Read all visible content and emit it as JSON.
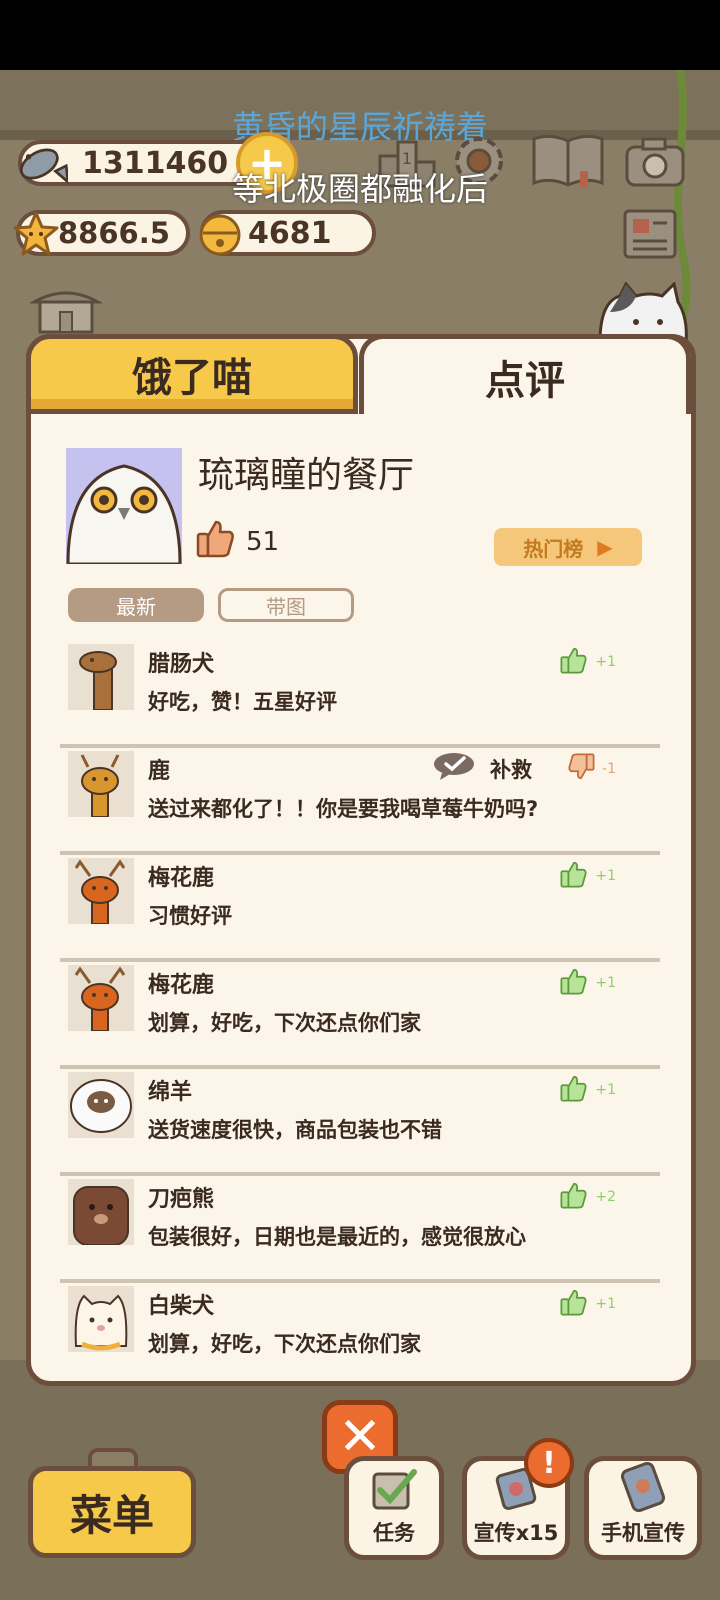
{
  "lyrics": {
    "line1": "黄昏的星辰祈祷着",
    "line2": "等北极圈都融化后"
  },
  "resources": {
    "fish": "1311460",
    "stars": "8866.5",
    "bells": "4681"
  },
  "tabs": {
    "hungry": "饿了喵",
    "review": "点评"
  },
  "profile": {
    "restaurant_name": "琉璃瞳的餐厅",
    "likes": "51",
    "hot_rank_label": "热门榜"
  },
  "filters": {
    "latest": "最新",
    "with_image": "带图"
  },
  "reviews": [
    {
      "name": "腊肠犬",
      "text": "好吃，赞！五星好评",
      "score": "+1",
      "type": "good",
      "animal": "dachshund"
    },
    {
      "name": "鹿",
      "text": "送过来都化了！！你是要我喝草莓牛奶吗?",
      "score": "-1",
      "type": "bad",
      "remedy": "补救",
      "animal": "deer"
    },
    {
      "name": "梅花鹿",
      "text": "习惯好评",
      "score": "+1",
      "type": "good",
      "animal": "sika-deer"
    },
    {
      "name": "梅花鹿",
      "text": "划算，好吃，下次还点你们家",
      "score": "+1",
      "type": "good",
      "animal": "sika-deer"
    },
    {
      "name": "绵羊",
      "text": "送货速度很快，商品包装也不错",
      "score": "+1",
      "type": "good",
      "animal": "sheep"
    },
    {
      "name": "刀疤熊",
      "text": "包装很好，日期也是最近的，感觉很放心",
      "score": "+2",
      "type": "good",
      "animal": "bear"
    },
    {
      "name": "白柴犬",
      "text": "划算，好吃，下次还点你们家",
      "score": "+1",
      "type": "good",
      "animal": "shiba"
    }
  ],
  "bottom": {
    "menu": "菜单",
    "task": "任务",
    "promo": "宣传x15",
    "phone_promo": "手机宣传",
    "badge": "!"
  },
  "colors": {
    "panel_bg": "#fcf6ea",
    "border": "#6b4e3c",
    "tab_active": "#f6c94a",
    "like_green": "#8ccf6a",
    "dislike_orange": "#e8a078",
    "close_orange": "#ec6b2f"
  },
  "icons": [
    "fish-icon",
    "star-icon",
    "bell-icon",
    "plus-icon",
    "rank-icon",
    "gear-icon",
    "book-icon",
    "camera-icon",
    "newspaper-icon",
    "shop-icon",
    "thumbs-up-icon",
    "thumbs-down-icon",
    "chat-check-icon",
    "close-icon",
    "task-icon",
    "promo-icon",
    "phone-promo-icon"
  ]
}
